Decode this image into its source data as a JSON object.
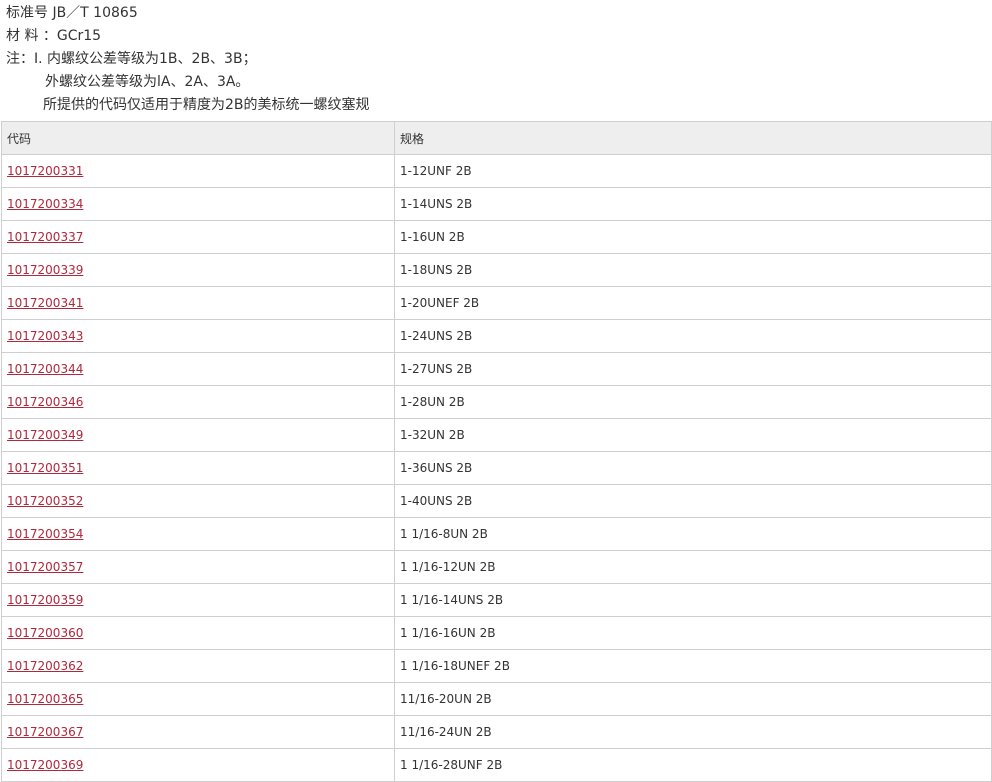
{
  "info": {
    "standard": "标准号 JB／T 10865",
    "material": "材 料 ：GCr15",
    "note_line1": "注：Ⅰ. 内螺纹公差等级为1B、2B、3B；",
    "note_line2": "外螺纹公差等级为lA、2A、3A。",
    "note_line3": "所提供的代码仅适用于精度为2B的美标统一螺纹塞规"
  },
  "table": {
    "headers": {
      "code": "代码",
      "spec": "规格"
    },
    "rows": [
      {
        "code": "1017200331",
        "spec": "1-12UNF 2B"
      },
      {
        "code": "1017200334",
        "spec": "1-14UNS 2B"
      },
      {
        "code": "1017200337",
        "spec": "1-16UN 2B"
      },
      {
        "code": "1017200339",
        "spec": "1-18UNS 2B"
      },
      {
        "code": "1017200341",
        "spec": "1-20UNEF 2B"
      },
      {
        "code": "1017200343",
        "spec": "1-24UNS 2B"
      },
      {
        "code": "1017200344",
        "spec": "1-27UNS 2B"
      },
      {
        "code": "1017200346",
        "spec": "1-28UN 2B"
      },
      {
        "code": "1017200349",
        "spec": "1-32UN 2B"
      },
      {
        "code": "1017200351",
        "spec": "1-36UNS 2B"
      },
      {
        "code": "1017200352",
        "spec": "1-40UNS 2B"
      },
      {
        "code": "1017200354",
        "spec": "1 1/16-8UN 2B"
      },
      {
        "code": "1017200357",
        "spec": "1 1/16-12UN 2B"
      },
      {
        "code": "1017200359",
        "spec": "1 1/16-14UNS 2B"
      },
      {
        "code": "1017200360",
        "spec": "1 1/16-16UN 2B"
      },
      {
        "code": "1017200362",
        "spec": "1 1/16-18UNEF 2B"
      },
      {
        "code": "1017200365",
        "spec": "11/16-20UN 2B"
      },
      {
        "code": "1017200367",
        "spec": "11/16-24UN 2B"
      },
      {
        "code": "1017200369",
        "spec": "1 1/16-28UNF 2B"
      }
    ]
  }
}
